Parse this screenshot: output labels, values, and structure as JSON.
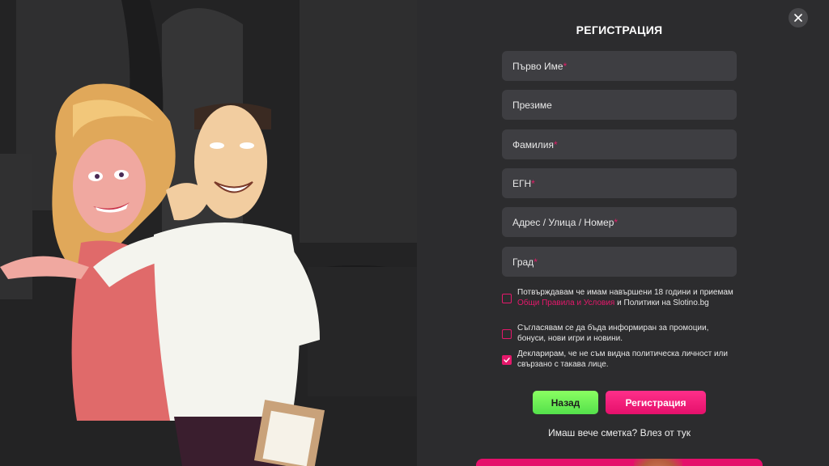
{
  "modal": {
    "title": "РЕГИСТРАЦИЯ",
    "close_icon": "close-icon"
  },
  "fields": [
    {
      "label": "Първо Име",
      "required": true
    },
    {
      "label": "Презиме",
      "required": false
    },
    {
      "label": "Фамилия",
      "required": true
    },
    {
      "label": "ЕГН",
      "required": true
    },
    {
      "label": "Адрес / Улица / Номер",
      "required": true
    },
    {
      "label": "Град",
      "required": true
    }
  ],
  "required_mark": "*",
  "checkboxes": [
    {
      "text_before": "Потвърждавам че имам навършени 18 години и приемам ",
      "link": "Общи Правила и Условия",
      "text_after": " и Политики на Slotino.bg",
      "checked": false
    },
    {
      "text": "Съгласявам се да бъда информиран за промоции, бонуси, нови игри и новини.",
      "checked": false
    },
    {
      "text": "Декларирам, че не съм видна политическа личност или свързано с такава лице.",
      "checked": true
    }
  ],
  "buttons": {
    "back_label": "Назад",
    "register_label": "Регистрация"
  },
  "login_prompt": "Имаш вече сметка? Влез от тук",
  "colors": {
    "accent": "#e5186b",
    "back_green": "#6cf255",
    "panel_bg": "#2c2c2e",
    "field_bg": "#3e3e42"
  }
}
